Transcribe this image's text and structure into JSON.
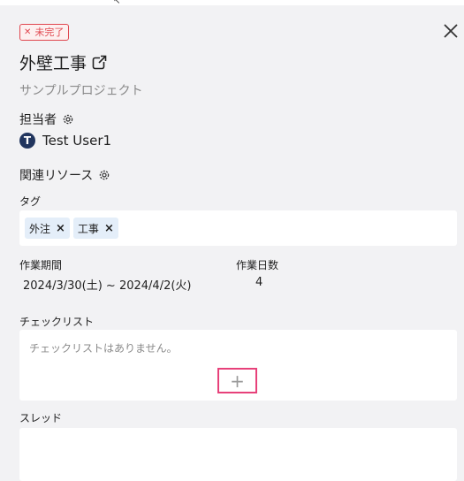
{
  "status": {
    "label": "未完了"
  },
  "task": {
    "title": "外壁工事",
    "project": "サンプルプロジェクト"
  },
  "assignee_section": {
    "label": "担当者",
    "user_initial": "T",
    "user_name": "Test User1"
  },
  "resources_section": {
    "label": "関連リソース"
  },
  "tags_section": {
    "label": "タグ",
    "tags": [
      {
        "label": "外注",
        "remove": "×"
      },
      {
        "label": "工事",
        "remove": "×"
      }
    ]
  },
  "schedule": {
    "period_label": "作業期間",
    "period_value": "2024/3/30(土) ~ 2024/4/2(火)",
    "days_label": "作業日数",
    "days_value": "4"
  },
  "checklist": {
    "label": "チェックリスト",
    "empty_text": "チェックリストはありません。",
    "add_symbol": "+"
  },
  "thread": {
    "label": "スレッド"
  },
  "colors": {
    "accent": "#e7417a",
    "status": "#e0474f",
    "tag_bg": "#e4eef9",
    "avatar": "#21355e"
  }
}
